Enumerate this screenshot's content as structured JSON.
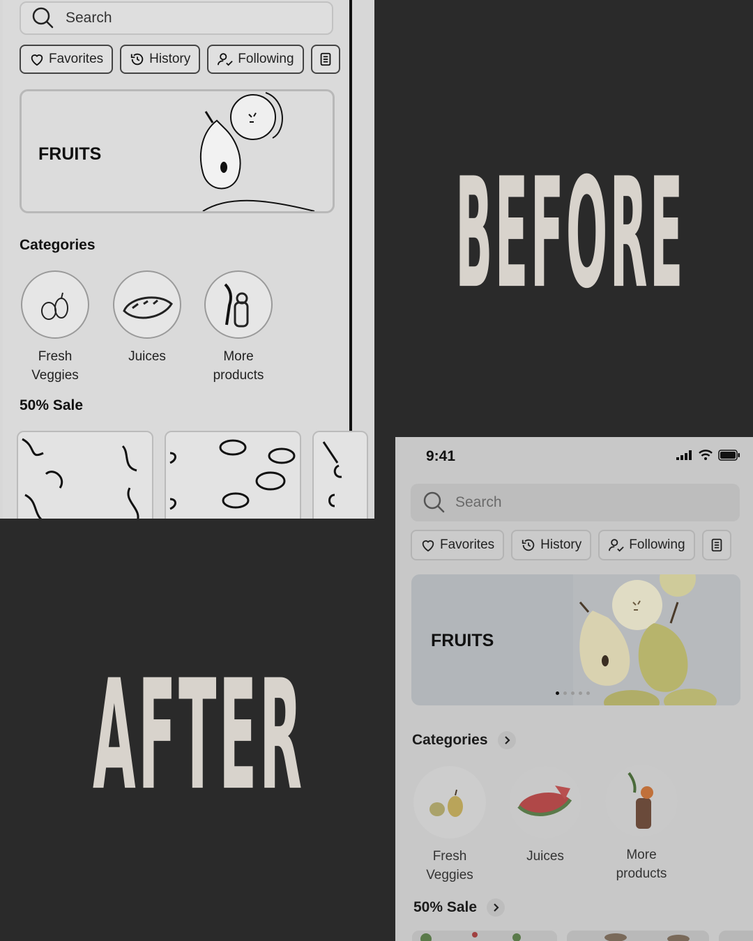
{
  "before": {
    "label": "BEFORE",
    "search": {
      "placeholder": "Search"
    },
    "chips": [
      {
        "label": "Favorites",
        "icon": "heart-icon"
      },
      {
        "label": "History",
        "icon": "history-icon"
      },
      {
        "label": "Following",
        "icon": "user-check-icon"
      },
      {
        "label": "",
        "icon": "document-icon"
      }
    ],
    "banner": {
      "title": "FRUITS"
    },
    "categories": {
      "title": "Categories",
      "items": [
        {
          "label": "Fresh\nVeggies"
        },
        {
          "label": "Juices"
        },
        {
          "label": "More\nproducts"
        }
      ]
    },
    "sale": {
      "title": "50% Sale"
    }
  },
  "after": {
    "label": "AFTER",
    "status": {
      "time": "9:41"
    },
    "search": {
      "placeholder": "Search"
    },
    "chips": [
      {
        "label": "Favorites",
        "icon": "heart-icon"
      },
      {
        "label": "History",
        "icon": "history-icon"
      },
      {
        "label": "Following",
        "icon": "user-check-icon"
      },
      {
        "label": "",
        "icon": "document-icon"
      }
    ],
    "banner": {
      "title": "FRUITS",
      "page_dots": 5,
      "active_dot": 1
    },
    "categories": {
      "title": "Categories",
      "items": [
        {
          "label": "Fresh\nVeggies"
        },
        {
          "label": "Juices"
        },
        {
          "label": "More\nproducts"
        }
      ]
    },
    "sale": {
      "title": "50% Sale"
    }
  },
  "colors": {
    "background": "#2a2a2a",
    "headline": "#d8d3cc"
  }
}
